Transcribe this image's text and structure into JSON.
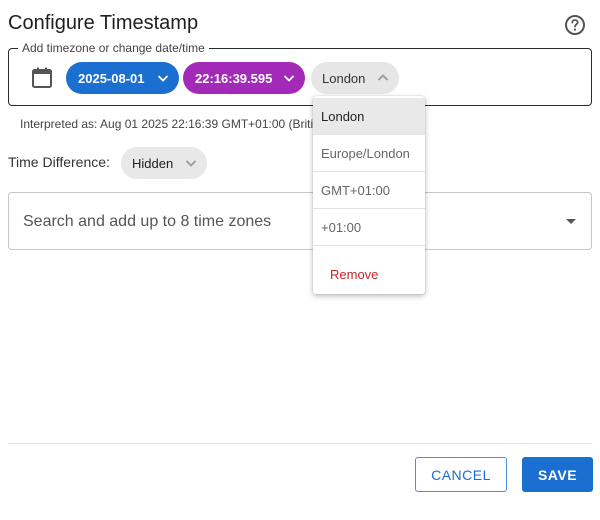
{
  "dialog": {
    "title": "Configure Timestamp",
    "legend": "Add timezone or change date/time",
    "interpreted": "Interpreted as: Aug 01 2025 22:16:39 GMT+01:00 (British Summer Time)",
    "time_difference_label": "Time Difference:",
    "time_difference_value": "Hidden",
    "search_placeholder": "Search and add up to 8 time zones",
    "cancel_label": "CANCEL",
    "save_label": "SAVE"
  },
  "chips": {
    "date": "2025-08-01",
    "time": "22:16:39.595",
    "timezone": "London"
  },
  "timezone_menu": {
    "items": [
      "London",
      "Europe/London",
      "GMT+01:00",
      "+01:00"
    ],
    "remove_label": "Remove"
  },
  "colors": {
    "primary": "#1b6fd1",
    "time_chip": "#a32ab8",
    "remove": "#c62828"
  }
}
